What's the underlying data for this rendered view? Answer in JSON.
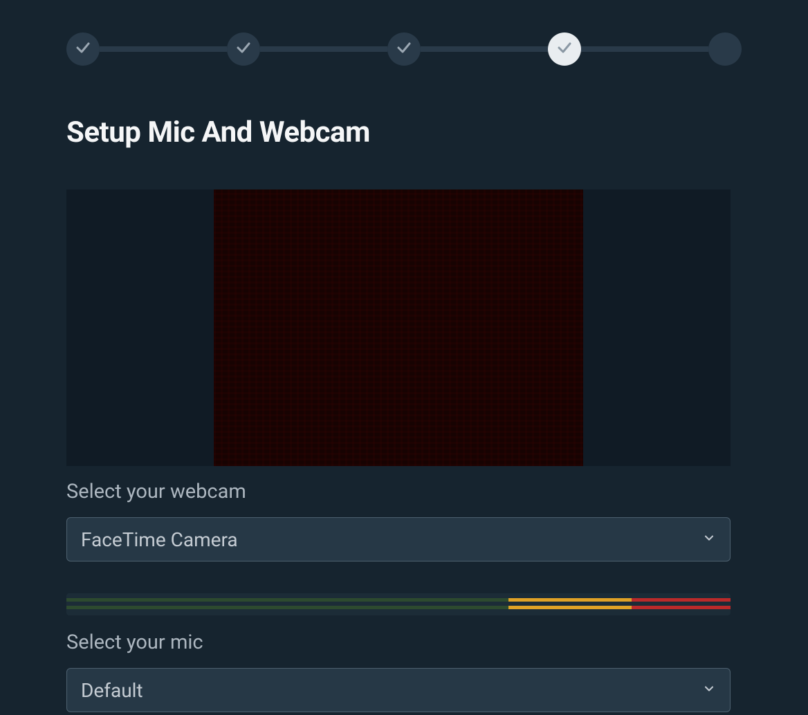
{
  "stepper": {
    "steps": [
      {
        "state": "completed"
      },
      {
        "state": "completed"
      },
      {
        "state": "completed"
      },
      {
        "state": "active"
      },
      {
        "state": "pending"
      }
    ]
  },
  "title": "Setup Mic And Webcam",
  "webcam": {
    "label": "Select your webcam",
    "selected": "FaceTime Camera"
  },
  "mic": {
    "label": "Select your mic",
    "selected": "Default"
  },
  "icons": {
    "check": "check-icon",
    "chevron": "chevron-down-icon"
  }
}
